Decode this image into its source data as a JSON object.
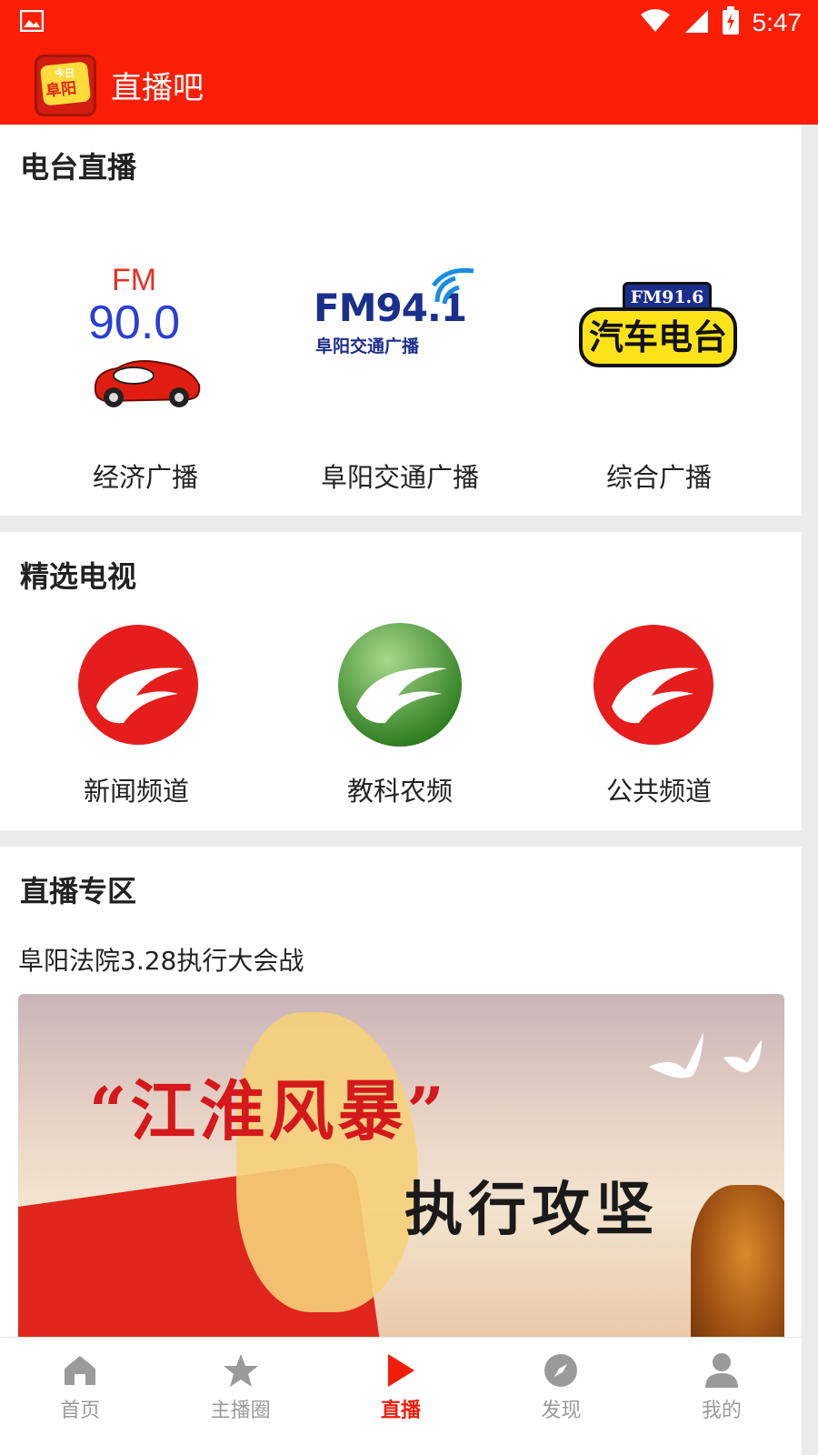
{
  "status_bar": {
    "time": "5:47"
  },
  "app_bar": {
    "title": "直播吧",
    "logo_line1": "今日",
    "logo_line2": "阜阳"
  },
  "radio": {
    "title": "电台直播",
    "items": [
      {
        "label": "经济广播",
        "logo_top": "FM",
        "logo_main": "90.0"
      },
      {
        "label": "阜阳交通广播",
        "logo_main": "FM94.1",
        "logo_sub": "阜阳交通广播"
      },
      {
        "label": "综合广播",
        "logo_top": "FM91.6",
        "logo_main": "汽车电台"
      }
    ]
  },
  "tv": {
    "title": "精选电视",
    "items": [
      {
        "label": "新闻频道",
        "color": "#e51d1d"
      },
      {
        "label": "教科农频",
        "color": "#3f8f2c"
      },
      {
        "label": "公共频道",
        "color": "#e51d1d"
      }
    ]
  },
  "live": {
    "title": "直播专区",
    "event_title": "阜阳法院3.28执行大会战",
    "banner_main": "“江淮风暴”",
    "banner_sub": "执行攻坚"
  },
  "bottom_nav": {
    "active": "直播",
    "items": [
      {
        "label": "首页",
        "icon": "home-icon"
      },
      {
        "label": "主播圈",
        "icon": "star-icon"
      },
      {
        "label": "直播",
        "icon": "play-icon"
      },
      {
        "label": "发现",
        "icon": "compass-icon"
      },
      {
        "label": "我的",
        "icon": "user-icon"
      }
    ]
  },
  "colors": {
    "accent": "#fa1e05",
    "active_tab": "#f21d09"
  }
}
